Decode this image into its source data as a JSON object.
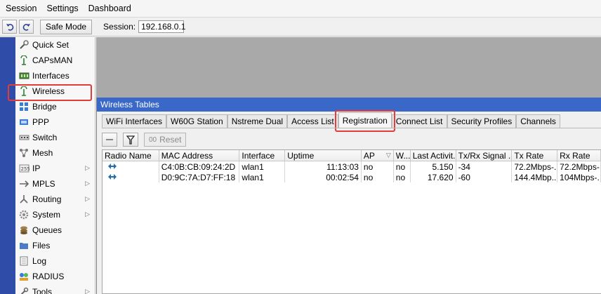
{
  "menu": [
    "Session",
    "Settings",
    "Dashboard"
  ],
  "toolbar": {
    "safe_mode_label": "Safe Mode",
    "session_label": "Session:",
    "session_value": "192.168.0.1"
  },
  "sidebar": {
    "items": [
      {
        "label": "Quick Set",
        "icon": "quick-set-icon"
      },
      {
        "label": "CAPsMAN",
        "icon": "antenna-icon"
      },
      {
        "label": "Interfaces",
        "icon": "interfaces-icon"
      },
      {
        "label": "Wireless",
        "icon": "wireless-icon"
      },
      {
        "label": "Bridge",
        "icon": "bridge-icon"
      },
      {
        "label": "PPP",
        "icon": "ppp-icon"
      },
      {
        "label": "Switch",
        "icon": "switch-icon"
      },
      {
        "label": "Mesh",
        "icon": "mesh-icon"
      },
      {
        "label": "IP",
        "icon": "ip-icon"
      },
      {
        "label": "MPLS",
        "icon": "mpls-icon"
      },
      {
        "label": "Routing",
        "icon": "routing-icon"
      },
      {
        "label": "System",
        "icon": "system-icon"
      },
      {
        "label": "Queues",
        "icon": "queues-icon"
      },
      {
        "label": "Files",
        "icon": "files-icon"
      },
      {
        "label": "Log",
        "icon": "log-icon"
      },
      {
        "label": "RADIUS",
        "icon": "radius-icon"
      },
      {
        "label": "Tools",
        "icon": "tools-icon"
      }
    ]
  },
  "window": {
    "title": "Wireless Tables",
    "tabs": [
      "WiFi Interfaces",
      "W60G Station",
      "Nstreme Dual",
      "Access List",
      "Registration",
      "Connect List",
      "Security Profiles",
      "Channels"
    ],
    "active_tab": "Registration",
    "reset_label": "Reset",
    "columns": [
      "Radio Name",
      "MAC Address",
      "Interface",
      "Uptime",
      "AP",
      "W...",
      "Last Activit...",
      "Tx/Rx Signal ...",
      "Tx Rate",
      "Rx Rate"
    ],
    "rows": [
      [
        "",
        "C4:0B:CB:09:24:2D",
        "wlan1",
        "11:13:03",
        "no",
        "no",
        "5.150",
        "-34",
        "72.2Mbps-...",
        "72.2Mbps-..."
      ],
      [
        "",
        "D0:9C:7A:D7:FF:18",
        "wlan1",
        "00:02:54",
        "no",
        "no",
        "17.620",
        "-60",
        "144.4Mbp...",
        "104Mbps-..."
      ]
    ]
  },
  "colors": {
    "title_bar": "#3968c8",
    "left_bar": "#2f4ca8",
    "highlight": "#e23b3b",
    "workspace": "#a9a9a9"
  }
}
